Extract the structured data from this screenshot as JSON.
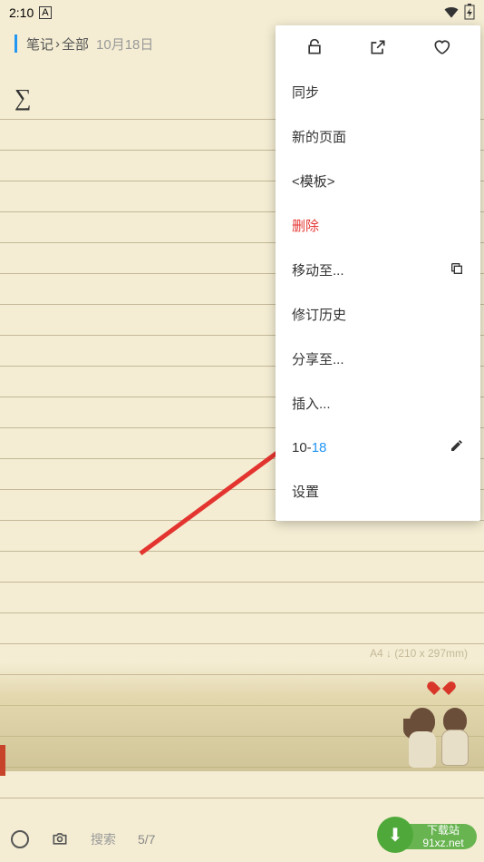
{
  "status": {
    "time": "2:10"
  },
  "header": {
    "crumb1": "笔记",
    "crumb2": "全部",
    "date": "10月18日"
  },
  "note": {
    "content": "∑",
    "page_dim": "A4  ↓ (210 x 297mm)"
  },
  "menu": {
    "sync": "同步",
    "new_page": "新的页面",
    "template": "<模板>",
    "delete": "删除",
    "move_to": "移动至...",
    "revision": "修订历史",
    "share": "分享至...",
    "insert": "插入...",
    "date_prefix": "10-",
    "date_suffix": "18",
    "settings": "设置"
  },
  "bottom": {
    "search": "搜索",
    "page": "5/7"
  },
  "watermark": {
    "line1": "下载站",
    "line2": "91xz.net"
  }
}
